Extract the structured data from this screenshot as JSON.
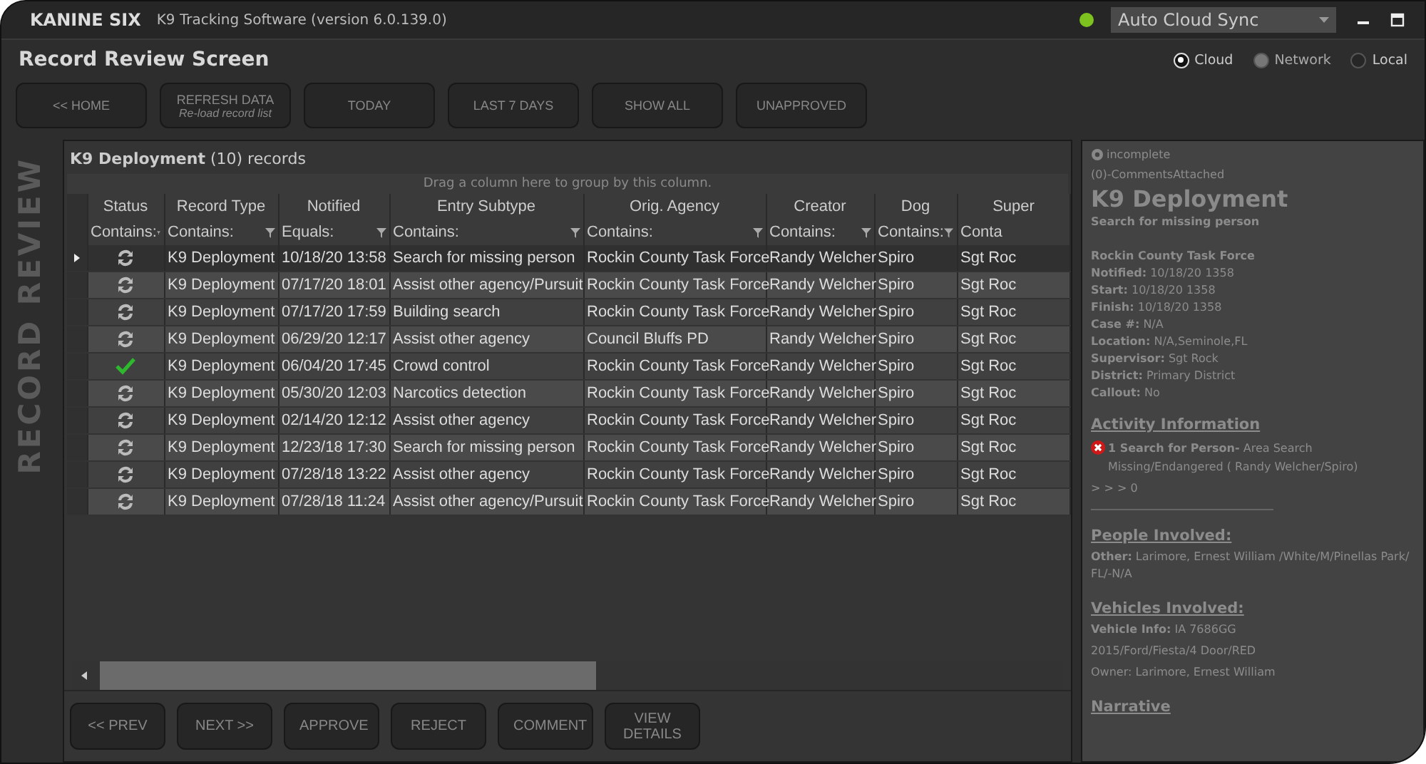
{
  "app": {
    "name": "KANINE SIX",
    "title": "K9 Tracking Software (version 6.0.139.0)",
    "sync_mode": {
      "value": "Auto Cloud Sync"
    }
  },
  "screen_title": "Record Review Screen",
  "storage_options": [
    {
      "label": "Cloud",
      "selected": true,
      "disabled": false
    },
    {
      "label": "Network",
      "selected": false,
      "disabled": true
    },
    {
      "label": "Local",
      "selected": false,
      "disabled": false
    }
  ],
  "toolbar": [
    {
      "label": "<< HOME"
    },
    {
      "label": "REFRESH DATA",
      "sublabel": "Re-load record list"
    },
    {
      "label": "TODAY"
    },
    {
      "label": "LAST 7 DAYS"
    },
    {
      "label": "SHOW ALL"
    },
    {
      "label": "UNAPPROVED"
    }
  ],
  "side_label": "RECORD REVIEW",
  "grid": {
    "title": "K9 Deployment",
    "count": "(10)",
    "count_label": "records",
    "group_hint": "Drag a column here to group by this column.",
    "columns": [
      {
        "label": "Status",
        "filter": "Contains:"
      },
      {
        "label": "Record Type",
        "filter": "Contains:"
      },
      {
        "label": "Notified",
        "filter": "Equals:"
      },
      {
        "label": "Entry Subtype",
        "filter": "Contains:"
      },
      {
        "label": "Orig. Agency",
        "filter": "Contains:"
      },
      {
        "label": "Creator",
        "filter": "Contains:"
      },
      {
        "label": "Dog",
        "filter": "Contains:"
      },
      {
        "label": "Super",
        "filter": "Conta"
      }
    ],
    "rows": [
      {
        "kind": "pending",
        "selected": true,
        "cells": [
          "",
          "K9 Deployment",
          "10/18/20 13:58",
          "Search for missing person",
          "Rockin County Task Force",
          "Randy Welcher",
          "Spiro",
          "Sgt Roc"
        ]
      },
      {
        "kind": "pending",
        "selected": false,
        "cells": [
          "",
          "K9 Deployment",
          "07/17/20 18:01",
          "Assist other agency/Pursuit",
          "Rockin County Task Force",
          "Randy Welcher",
          "Spiro",
          "Sgt Roc"
        ]
      },
      {
        "kind": "pending",
        "selected": false,
        "cells": [
          "",
          "K9 Deployment",
          "07/17/20 17:59",
          "Building search",
          "Rockin County Task Force",
          "Randy Welcher",
          "Spiro",
          "Sgt Roc"
        ]
      },
      {
        "kind": "pending",
        "selected": false,
        "cells": [
          "",
          "K9 Deployment",
          "06/29/20 12:17",
          "Assist other agency",
          "Council Bluffs PD",
          "Randy Welcher",
          "Spiro",
          "Sgt Roc"
        ]
      },
      {
        "kind": "approved",
        "selected": false,
        "cells": [
          "",
          "K9 Deployment",
          "06/04/20 17:45",
          "Crowd control",
          "Rockin County Task Force",
          "Randy Welcher",
          "Spiro",
          "Sgt Roc"
        ]
      },
      {
        "kind": "pending",
        "selected": false,
        "cells": [
          "",
          "K9 Deployment",
          "05/30/20 12:03",
          "Narcotics detection",
          "Rockin County Task Force",
          "Randy Welcher",
          "Spiro",
          "Sgt Roc"
        ]
      },
      {
        "kind": "pending",
        "selected": false,
        "cells": [
          "",
          "K9 Deployment",
          "02/14/20 12:12",
          "Assist other agency",
          "Rockin County Task Force",
          "Randy Welcher",
          "Spiro",
          "Sgt Roc"
        ]
      },
      {
        "kind": "pending",
        "selected": false,
        "cells": [
          "",
          "K9 Deployment",
          "12/23/18 17:30",
          "Search for missing person",
          "Rockin County Task Force",
          "Randy Welcher",
          "Spiro",
          "Sgt Roc"
        ]
      },
      {
        "kind": "pending",
        "selected": false,
        "cells": [
          "",
          "K9 Deployment",
          "07/28/18 13:22",
          "Assist other agency",
          "Rockin County Task Force",
          "Randy Welcher",
          "Spiro",
          "Sgt Roc"
        ]
      },
      {
        "kind": "pending",
        "selected": false,
        "cells": [
          "",
          "K9 Deployment",
          "07/28/18 11:24",
          "Assist other agency/Pursuit",
          "Rockin County Task Force",
          "Randy Welcher",
          "Spiro",
          "Sgt Roc"
        ]
      }
    ]
  },
  "actions": [
    {
      "label": "<< PREV"
    },
    {
      "label": "NEXT >>"
    },
    {
      "label": "APPROVE"
    },
    {
      "label": "REJECT"
    },
    {
      "label": "COMMENT"
    },
    {
      "label": "VIEW DETAILS"
    }
  ],
  "detail": {
    "status": "incomplete",
    "comments": "(0)-CommentsAttached",
    "title": "K9 Deployment",
    "subtitle": "Search for missing person",
    "agency": "Rockin County Task Force",
    "fields": [
      "**Notified:** 10/18/20 1358",
      "**Start:** 10/18/20 1358",
      "**Finish:** 10/18/20 1358",
      "**Case #:** N/A",
      "**Location:** N/A,Seminole,FL",
      "**Supervisor:** Sgt Rock",
      "**District:** Primary District",
      "**Callout:** No"
    ],
    "sections": [
      {
        "heading": "Activity Information",
        "kind": "activity",
        "lines": [
          "**1 Search for Person-** Area Search Missing/Endangered ( Randy Welcher/Spiro)",
          "> > > 0"
        ]
      },
      {
        "heading": "People Involved:",
        "kind": "text",
        "lines": [
          "**Other:** Larimore, Ernest William /White/M/Pinellas Park/ FL/-N/A"
        ]
      },
      {
        "heading": "Vehicles Involved:",
        "kind": "text",
        "lines": [
          "**Vehicle Info:** IA 7686GG",
          "2015/Ford/Fiesta/4 Door/RED",
          "Owner: Larimore, Ernest William"
        ]
      },
      {
        "heading": "Narrative",
        "kind": "text"
      }
    ]
  }
}
